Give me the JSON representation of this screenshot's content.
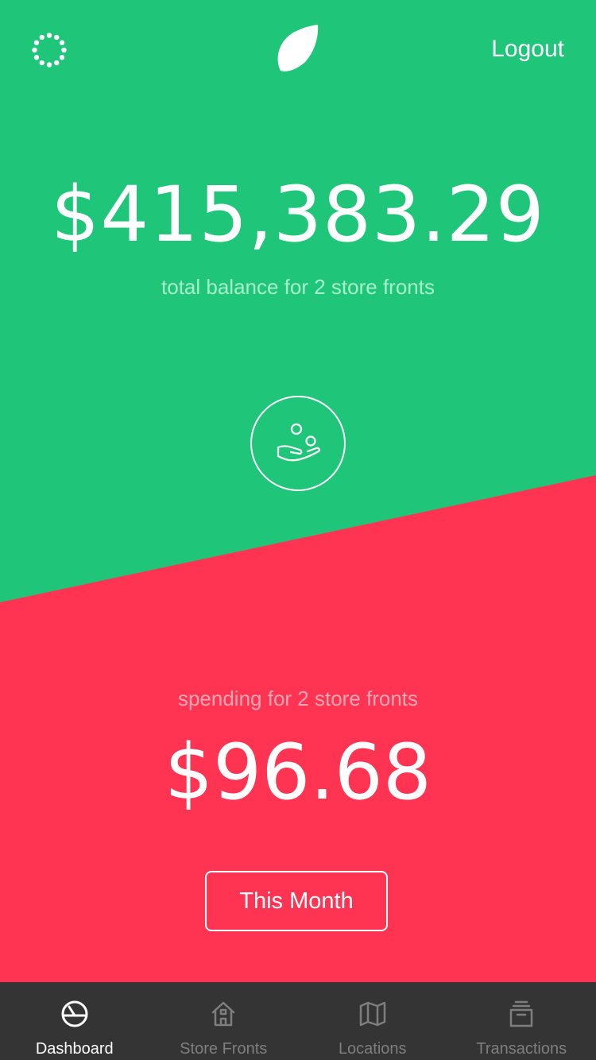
{
  "header": {
    "left_icon": "spinner-icon",
    "logo_icon": "leaf-icon",
    "logout_label": "Logout"
  },
  "balance": {
    "amount": "$415,383.29",
    "caption": "total balance for 2 store fronts",
    "icon": "hand-coins-icon"
  },
  "spending": {
    "caption": "spending for 2 store fronts",
    "amount": "$96.68",
    "period_label": "This Month"
  },
  "tabs": [
    {
      "label": "Dashboard",
      "icon": "dashboard-gauge-icon",
      "active": true
    },
    {
      "label": "Store Fronts",
      "icon": "store-icon",
      "active": false
    },
    {
      "label": "Locations",
      "icon": "map-icon",
      "active": false
    },
    {
      "label": "Transactions",
      "icon": "archive-box-icon",
      "active": false
    }
  ],
  "colors": {
    "green": "#1FC67A",
    "red": "#FE3452",
    "tab_bar": "#343434",
    "tab_inactive": "#7E7E7E",
    "tab_active": "#FFFFFF"
  }
}
